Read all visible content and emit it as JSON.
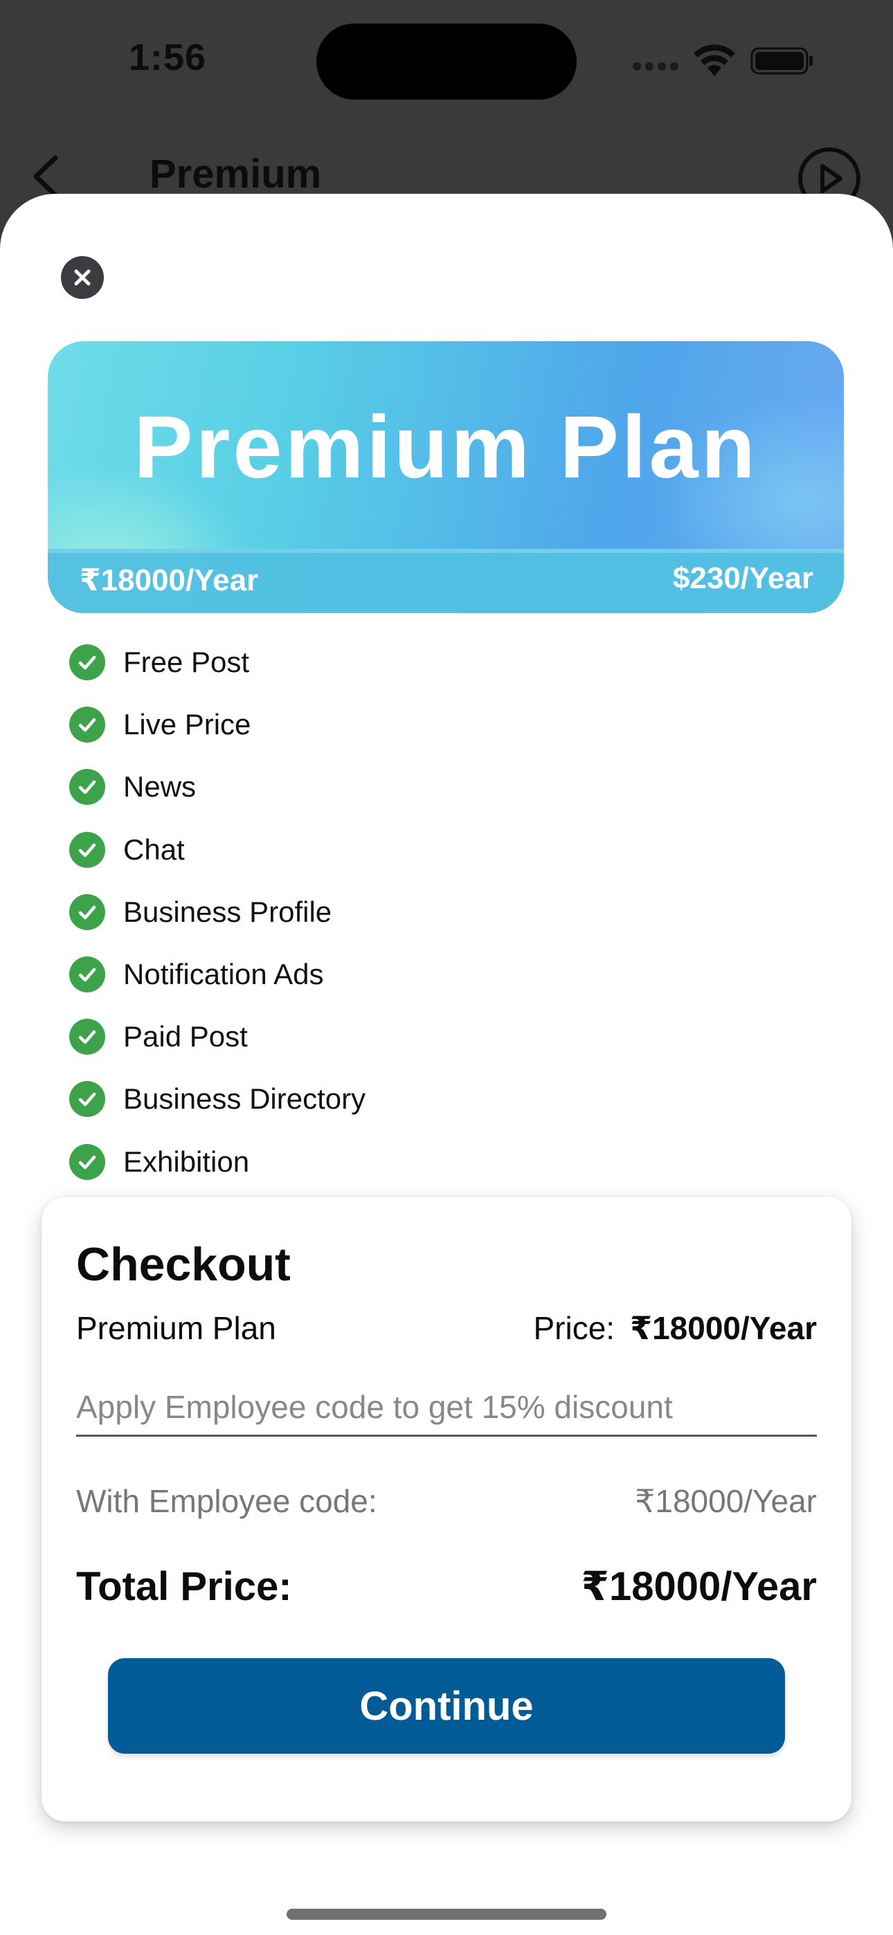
{
  "status_bar": {
    "time": "1:56"
  },
  "background_screen": {
    "title": "Premium"
  },
  "plan_card": {
    "title": "Premium Plan",
    "price_inr": "₹18000/Year",
    "price_usd": "$230/Year"
  },
  "features": [
    "Free Post",
    "Live Price",
    "News",
    "Chat",
    "Business Profile",
    "Notification Ads",
    "Paid Post",
    "Business Directory",
    "Exhibition"
  ],
  "checkout": {
    "title": "Checkout",
    "plan_name": "Premium Plan",
    "price_label": "Price:",
    "price_value": "₹18000/Year",
    "employee_code_placeholder": "Apply Employee code to get 15% discount",
    "employee_code_value": "",
    "with_code_label": "With Employee code:",
    "with_code_value": "₹18000/Year",
    "total_label": "Total Price:",
    "total_value": "₹18000/Year",
    "continue_label": "Continue"
  },
  "colors": {
    "accent_button": "#005b96",
    "check_green": "#3da34a",
    "close_button": "#3c3b40"
  },
  "icons": {
    "close": "close-icon",
    "check": "checkmark-circle-icon",
    "back": "chevron-left-icon",
    "play": "play-circle-icon"
  }
}
